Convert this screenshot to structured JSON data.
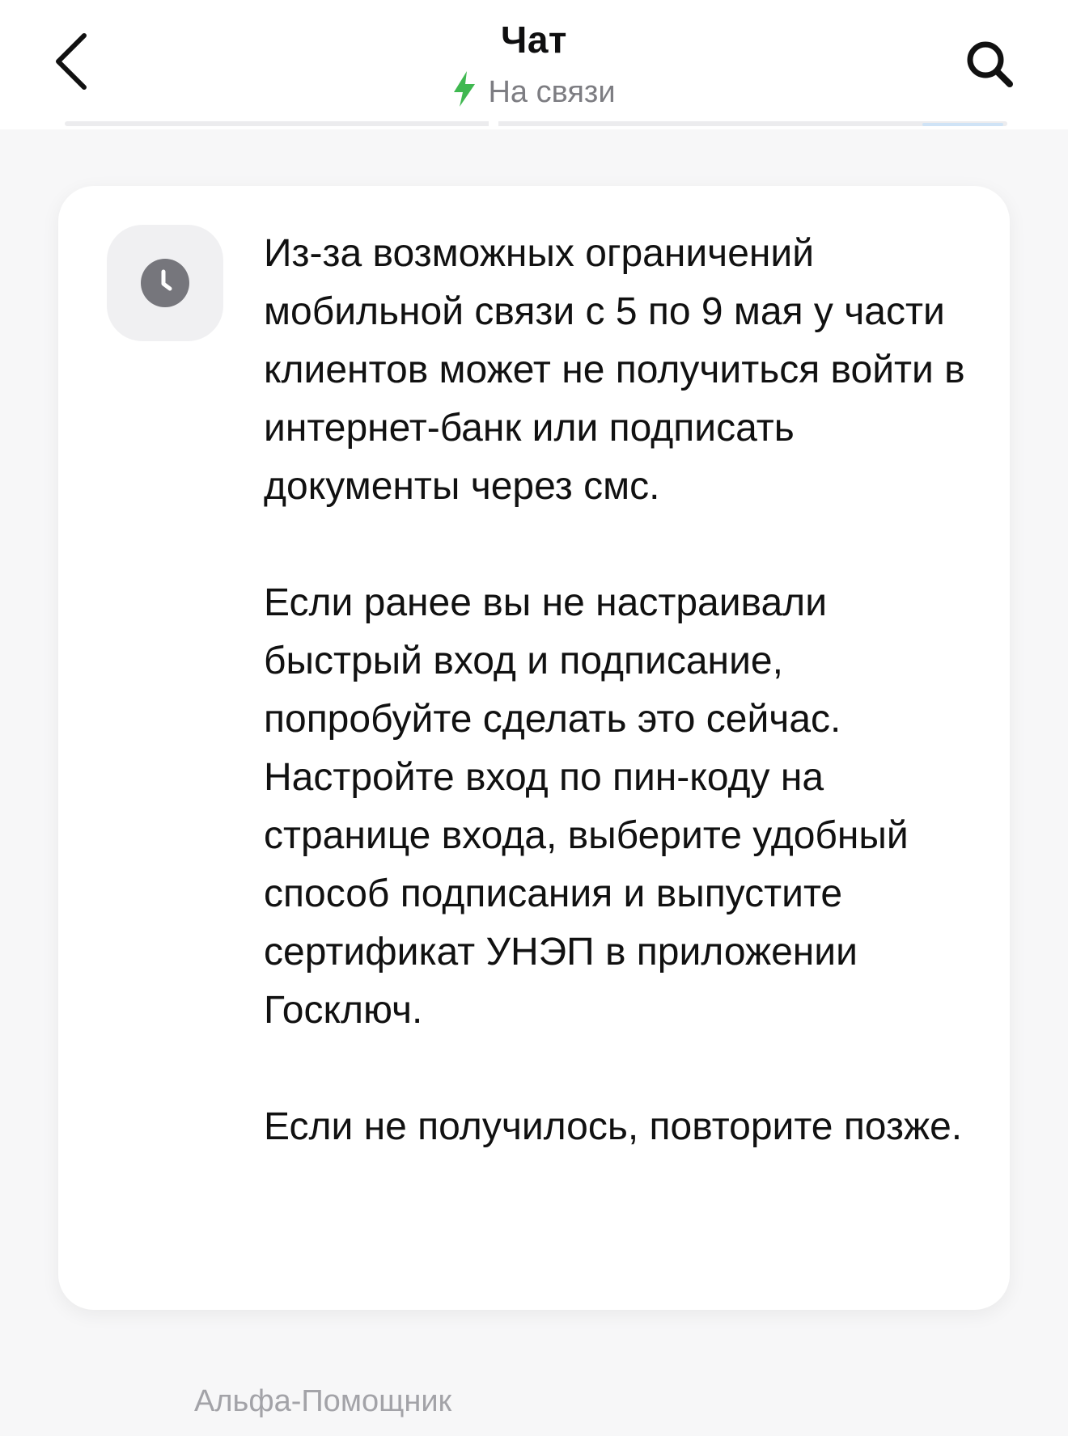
{
  "header": {
    "title": "Чат",
    "status": "На связи",
    "back_icon": "chevron-left-icon",
    "search_icon": "search-icon",
    "status_icon": "bolt-icon",
    "status_icon_color": "#3fb850"
  },
  "message": {
    "icon": "clock-icon",
    "paragraphs": [
      "Из-за возможных ограничений мобильной связи с 5 по 9 мая у части клиентов может не получиться войти в интернет-банк или подписать документы через смс.",
      "Если ранее вы не настраивали быстрый вход и подписание, попробуйте сделать это сейчас. Настройте вход по пин-коду на странице входа, выберите удобный способ подписания и выпустите сертификат УНЭП в приложении Госключ.",
      "Если не получилось, повторите позже."
    ]
  },
  "sender": {
    "name": "Альфа-Помощник"
  }
}
